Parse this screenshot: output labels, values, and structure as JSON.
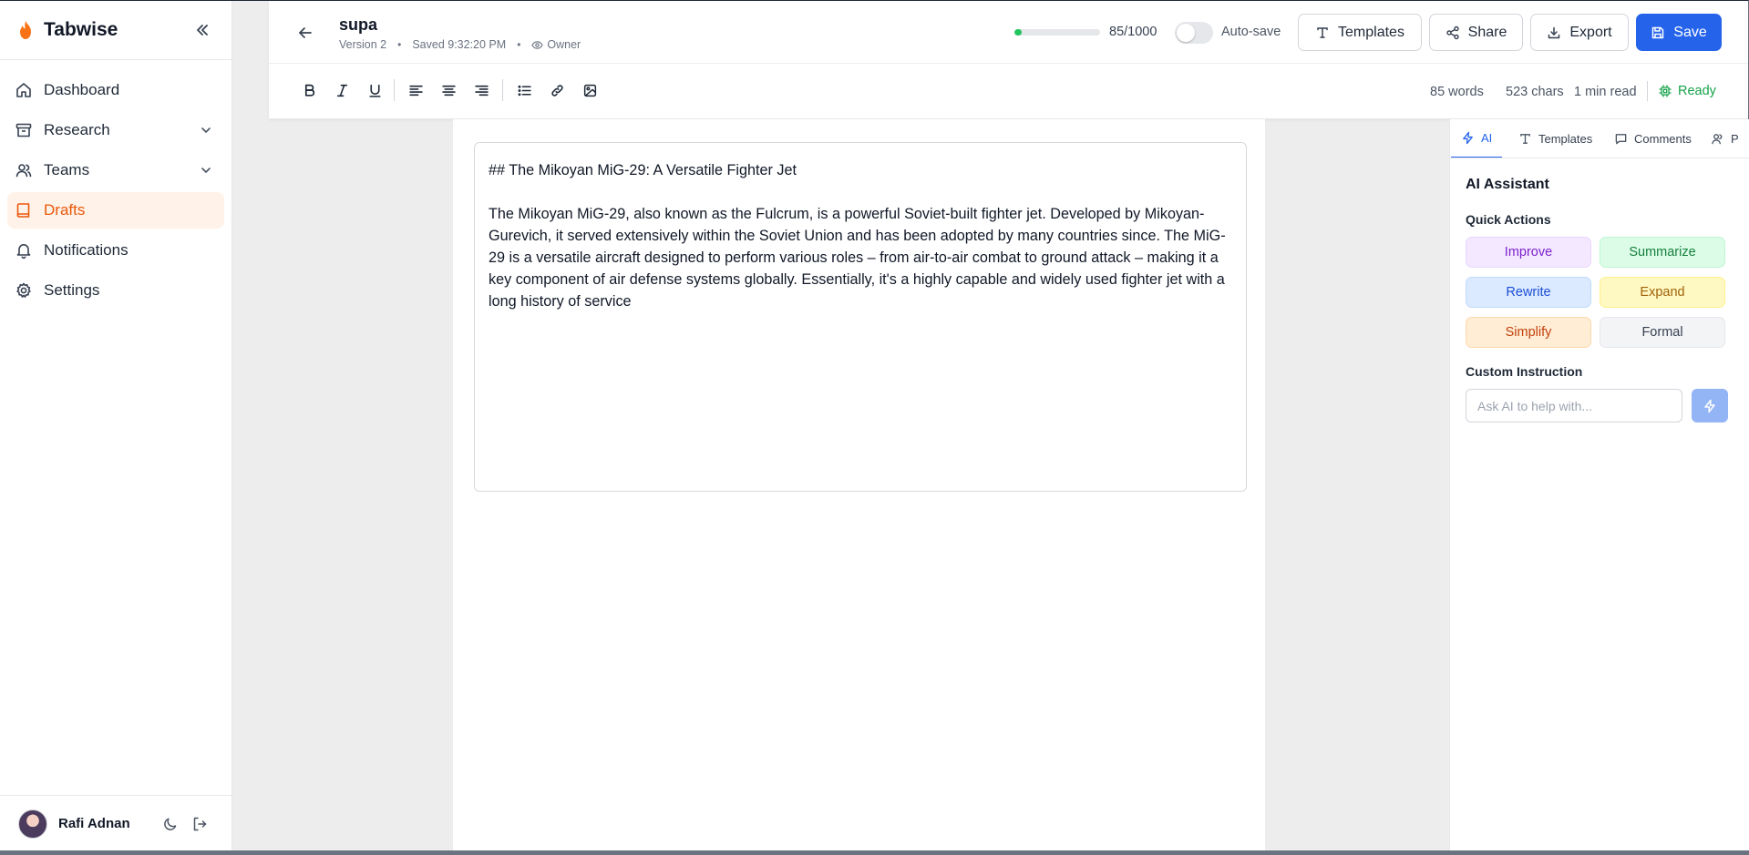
{
  "app": {
    "name": "Tabwise",
    "brand_color": "#ea580c"
  },
  "sidebar": {
    "items": [
      {
        "label": "Dashboard",
        "icon": "home-icon"
      },
      {
        "label": "Research",
        "icon": "archive-icon",
        "expandable": true
      },
      {
        "label": "Teams",
        "icon": "users-icon",
        "expandable": true
      },
      {
        "label": "Drafts",
        "icon": "book-icon",
        "active": true
      },
      {
        "label": "Notifications",
        "icon": "bell-icon"
      },
      {
        "label": "Settings",
        "icon": "gear-icon"
      }
    ],
    "user": {
      "name": "Rafi Adnan"
    }
  },
  "document": {
    "title": "supa",
    "version": "Version 2",
    "saved": "Saved 9:32:20 PM",
    "role": "Owner",
    "word_progress": 0.085,
    "word_progress_label": "85/1000",
    "autosave_label": "Auto-save",
    "autosave_on": false
  },
  "actions": {
    "templates": "Templates",
    "share": "Share",
    "export": "Export",
    "save": "Save"
  },
  "stats": {
    "words": "85 words",
    "chars": "523 chars",
    "read_time": "1 min read",
    "status": "Ready"
  },
  "editor": {
    "heading": "## The Mikoyan MiG-29: A Versatile Fighter Jet",
    "body": "The Mikoyan MiG-29, also known as the Fulcrum, is a powerful Soviet-built fighter jet. Developed by Mikoyan-Gurevich, it served extensively within the Soviet Union and has been adopted by many countries since. The MiG-29 is a versatile aircraft designed to perform various roles – from air-to-air combat to ground attack – making it a key component of air defense systems globally. Essentially, it's a highly capable and widely used fighter jet with a long history of service"
  },
  "panel": {
    "tabs": [
      "AI",
      "Templates",
      "Comments",
      "P"
    ],
    "title": "AI Assistant",
    "quick_actions_label": "Quick Actions",
    "quick_actions": [
      "Improve",
      "Summarize",
      "Rewrite",
      "Expand",
      "Simplify",
      "Formal"
    ],
    "custom_label": "Custom Instruction",
    "input_placeholder": "Ask AI to help with..."
  }
}
